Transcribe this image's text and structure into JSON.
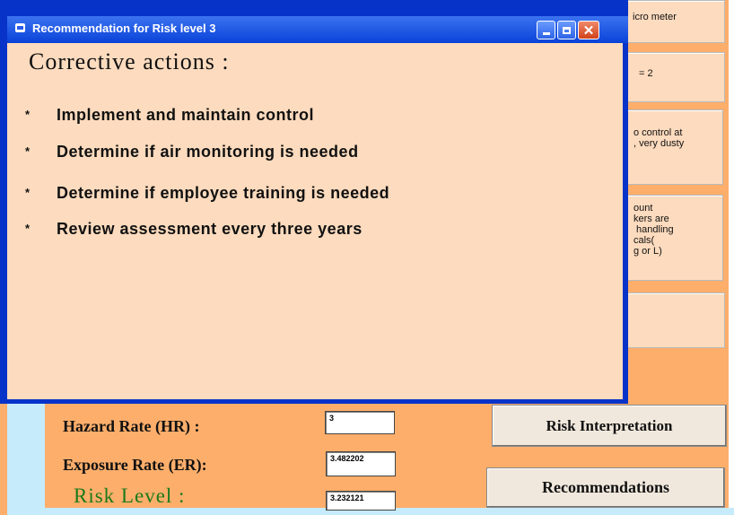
{
  "main_form": {
    "info_boxes": [
      [
        "icro meter"
      ],
      [
        "= 2"
      ],
      [
        "o control at",
        ", very dusty"
      ],
      [
        "ount",
        "kers are",
        " handling",
        "cals(",
        "g or L)"
      ],
      []
    ],
    "hazard_rate": {
      "label": "Hazard Rate (HR) :",
      "value": "3"
    },
    "exposure_rate": {
      "label": "Exposure Rate (ER):",
      "value": "3.482202"
    },
    "risk_level": {
      "label": "Risk Level :",
      "value": "3.232121"
    },
    "buttons": {
      "risk_interpretation": "Risk Interpretation",
      "recommendations": "Recommendations"
    }
  },
  "popup": {
    "title": "Recommendation for  Risk level 3",
    "heading": "Corrective actions :",
    "bullet": "*",
    "actions": [
      "Implement and maintain control",
      "Determine if air monitoring is needed",
      "Determine if employee training is needed",
      "Review assessment every three years"
    ],
    "controls": {
      "close": "✕"
    }
  },
  "colors": {
    "form_background": "#fdae6b",
    "panel_background": "#fddbbe",
    "titlebar": "#0a42d9",
    "risk_label": "#1a7a1a",
    "left_strip": "#c6ebfa"
  }
}
